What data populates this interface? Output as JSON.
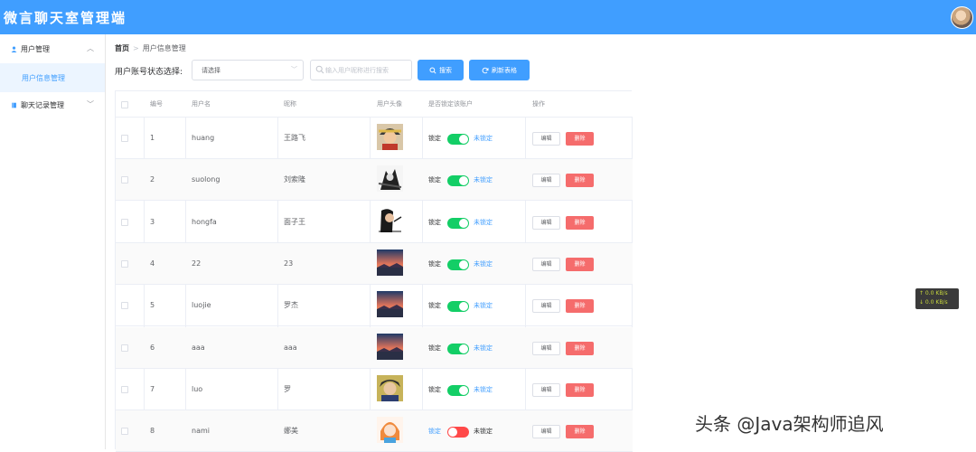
{
  "header": {
    "app_title": "微言聊天室管理端",
    "avatar": "user-avatar"
  },
  "sidebar": {
    "groups": [
      {
        "label": "用户管理",
        "icon": "user-icon",
        "arrow": "^"
      },
      {
        "label": "聊天记录管理",
        "icon": "book-icon",
        "arrow": "v"
      }
    ],
    "active_item": "用户信息管理"
  },
  "breadcrumb": {
    "home": "首页",
    "separator": ">",
    "current": "用户信息管理"
  },
  "filter": {
    "label": "用户账号状态选择:",
    "select_value": "请选择",
    "search_placeholder": "输入用户昵称进行搜索",
    "search_button": "搜索",
    "refresh_button": "刷新表格"
  },
  "table": {
    "columns": [
      "",
      "编号",
      "用户名",
      "昵称",
      "用户头像",
      "是否锁定该账户",
      "操作"
    ],
    "lock_label": "锁定",
    "unlock_label": "未锁定",
    "edit_label": "编辑",
    "delete_label": "删除",
    "rows": [
      {
        "id": "1",
        "username": "huang",
        "nickname": "王路飞",
        "avatar": "anime-avatar-1",
        "locked": false
      },
      {
        "id": "2",
        "username": "suolong",
        "nickname": "刘索隆",
        "avatar": "anime-avatar-2",
        "locked": false
      },
      {
        "id": "3",
        "username": "hongfa",
        "nickname": "面子王",
        "avatar": "anime-avatar-3",
        "locked": false
      },
      {
        "id": "4",
        "username": "22",
        "nickname": "23",
        "avatar": "sunset-avatar",
        "locked": false
      },
      {
        "id": "5",
        "username": "luojie",
        "nickname": "罗杰",
        "avatar": "sunset-avatar",
        "locked": false
      },
      {
        "id": "6",
        "username": "aaa",
        "nickname": "aaa",
        "avatar": "sunset-avatar",
        "locked": false
      },
      {
        "id": "7",
        "username": "luo",
        "nickname": "罗",
        "avatar": "anime-avatar-4",
        "locked": false
      },
      {
        "id": "8",
        "username": "nami",
        "nickname": "娜美",
        "avatar": "anime-avatar-5",
        "locked": true
      }
    ]
  },
  "colors": {
    "primary": "#409eff",
    "switch_on": "#13ce66",
    "switch_off": "#ff4949",
    "danger": "#f56c6c"
  },
  "netspeed": {
    "up": "↑ 0.0 KB/s",
    "down": "↓ 0.0 KB/s"
  },
  "watermark": "头条 @Java架构师追风"
}
